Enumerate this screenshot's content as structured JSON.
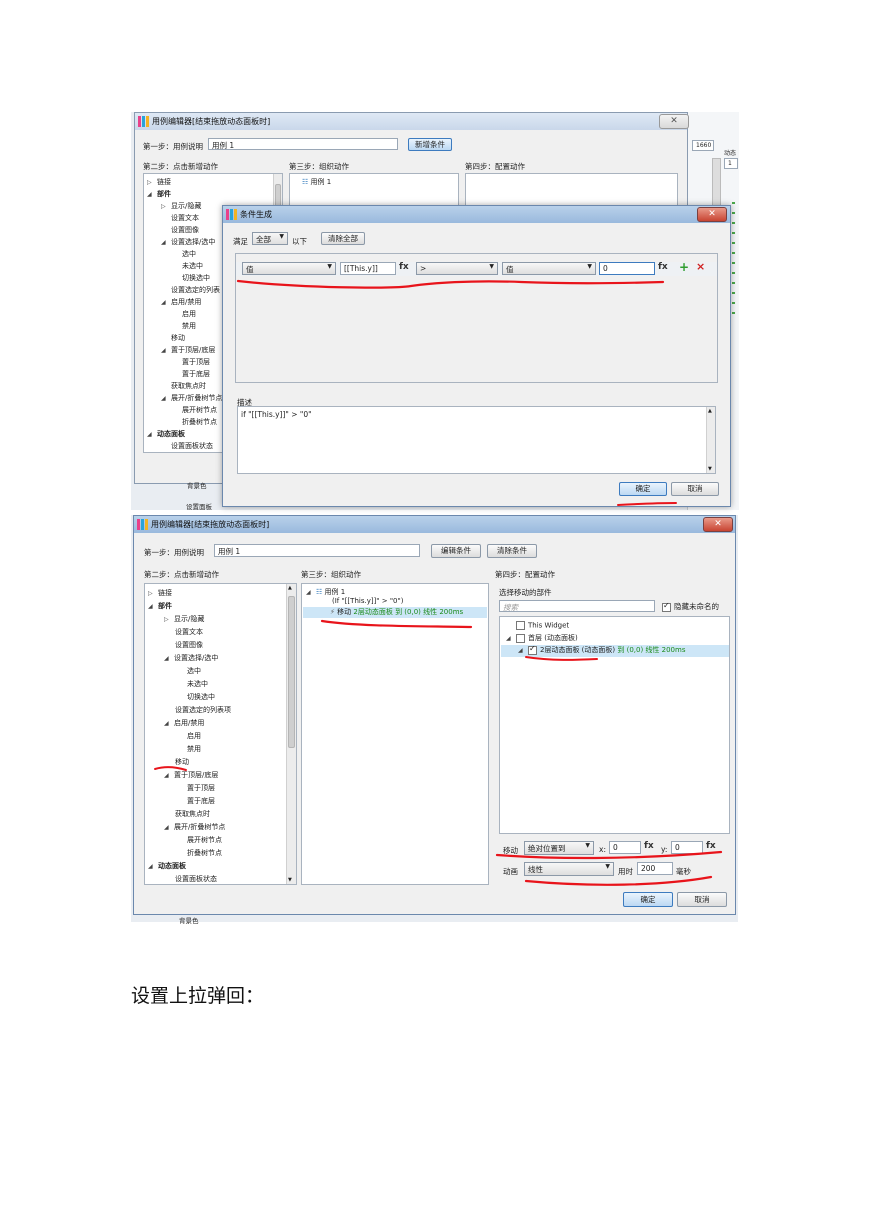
{
  "dialog1": {
    "title": "用例编辑器[结束拖放动态面板时]",
    "step1_label": "第一步：用例说明",
    "case_name_value": "用例 1",
    "add_condition_button": "新增条件",
    "step2_label": "第二步：点击新增动作",
    "step3_label": "第三步：组织动作",
    "step4_label": "第四步：配置动作",
    "case_item": "用例 1",
    "tree": [
      "链接",
      "部件",
      "显示/隐藏",
      "设置文本",
      "设置图像",
      "设置选择/选中",
      "选中",
      "未选中",
      "切换选中",
      "设置选定的列表",
      "启用/禁用",
      "启用",
      "禁用",
      "移动",
      "置于顶层/底层",
      "置于顶层",
      "置于底层",
      "获取焦点时",
      "展开/折叠树节点",
      "展开树节点",
      "折叠树节点",
      "动态面板",
      "设置面板状态"
    ],
    "partial_bg_text": "背景色",
    "partial_bg_text2": "设置面板"
  },
  "condition_dialog": {
    "title": "条件生成",
    "satisfy_label": "满足",
    "satisfy_value": "全部",
    "following_label": "以下",
    "clear_all_button": "清除全部",
    "row": {
      "left_type": "值",
      "left_value": "[[This.y]]",
      "operator": ">",
      "right_type": "值",
      "right_value": "0"
    },
    "fx": "fx",
    "add_icon": "+",
    "remove_icon": "×",
    "description_label": "描述",
    "description_text": "if \"[[This.y]]\" > \"0\"",
    "ok_button": "确定",
    "cancel_button": "取消"
  },
  "right_partial": {
    "val1": "1660",
    "val2": "1",
    "label": "动态"
  },
  "dialog2": {
    "title": "用例编辑器[结束拖放动态面板时]",
    "step1_label": "第一步：用例说明",
    "case_name_value": "用例 1",
    "edit_condition_button": "编辑条件",
    "clear_condition_button": "清除条件",
    "step2_label": "第二步：点击新增动作",
    "step3_label": "第三步：组织动作",
    "step4_label": "第四步：配置动作",
    "case_item": "用例 1",
    "case_condition": "(If \"[[This.y]]\" > \"0\")",
    "action_prefix": "移动",
    "action_text": "2层动态面板 到 (0,0) 线性 200ms",
    "tree": [
      "链接",
      "部件",
      "显示/隐藏",
      "设置文本",
      "设置图像",
      "设置选择/选中",
      "选中",
      "未选中",
      "切换选中",
      "设置选定的列表项",
      "启用/禁用",
      "启用",
      "禁用",
      "移动",
      "置于顶层/底层",
      "置于顶层",
      "置于底层",
      "获取焦点时",
      "展开/折叠树节点",
      "展开树节点",
      "折叠树节点",
      "动态面板",
      "设置面板状态"
    ],
    "select_widget_label": "选择移动的部件",
    "search_placeholder": "搜索",
    "hide_unnamed_label": "隐藏未命名的",
    "widgets": [
      "This Widget",
      "首层 (动态面板)",
      "2层动态面板 (动态面板)"
    ],
    "widget_suffix": "到 (0,0) 线性 200ms",
    "move_label": "移动",
    "move_value": "绝对位置到",
    "x_label": "x:",
    "x_value": "0",
    "y_label": "y:",
    "y_value": "0",
    "fx": "fx",
    "anim_label": "动画",
    "anim_value": "线性",
    "duration_label": "用时",
    "duration_value": "200",
    "ms_label": "毫秒",
    "ok_button": "确定",
    "cancel_button": "取消",
    "partial_bg_text": "背景色"
  },
  "caption": "设置上拉弹回："
}
